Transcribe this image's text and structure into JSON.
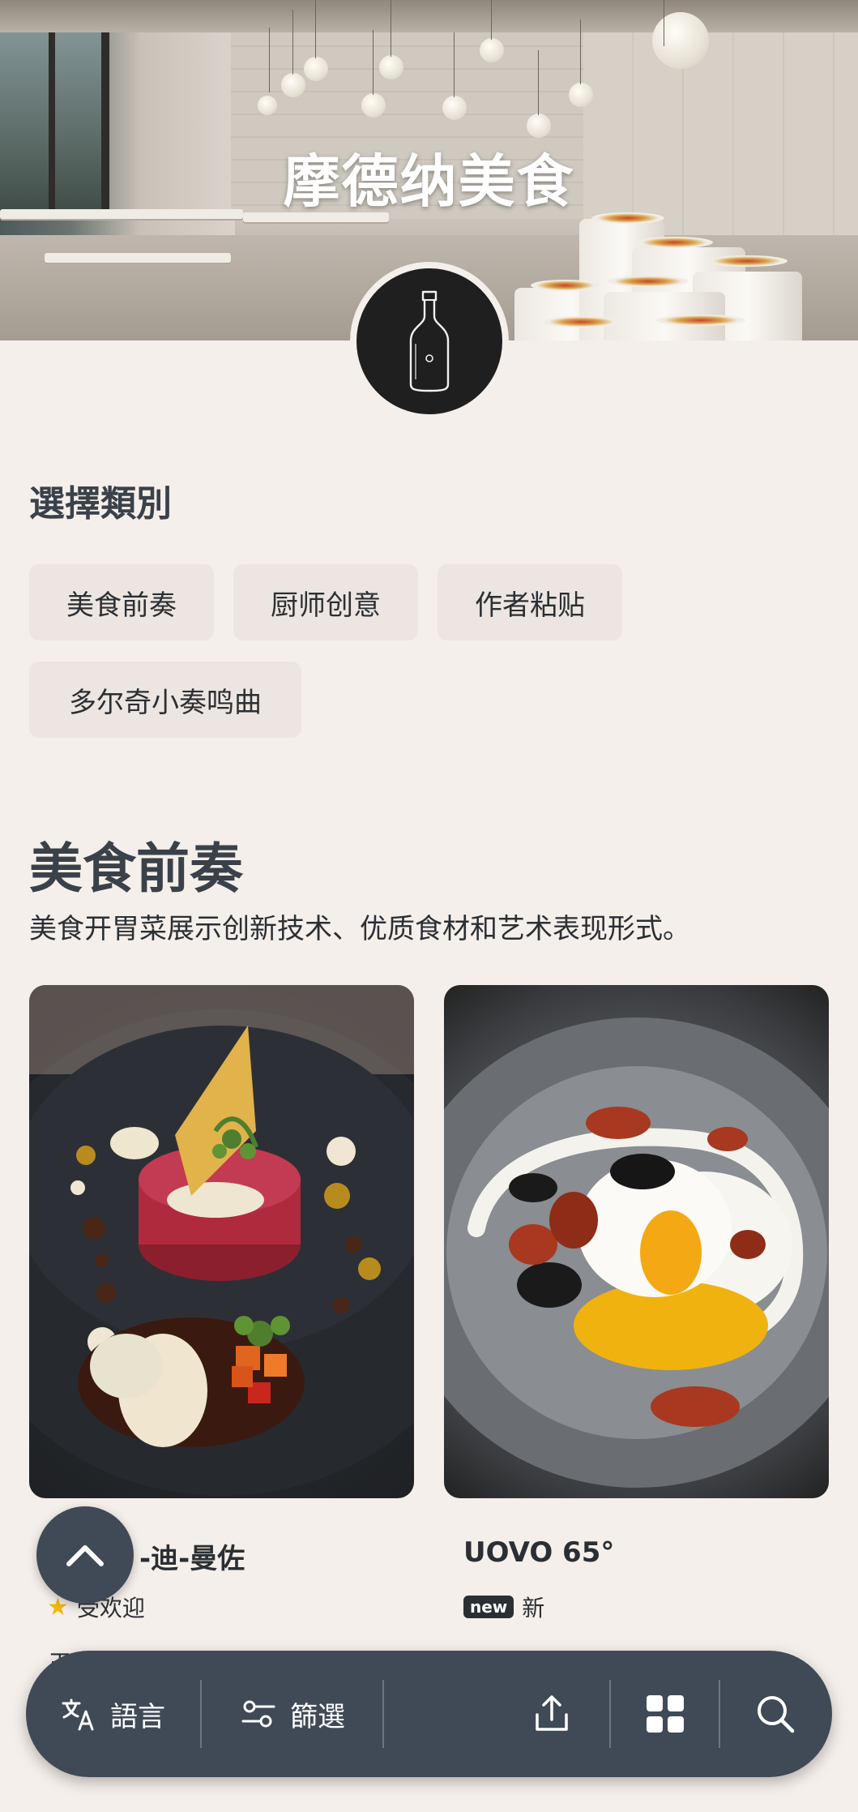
{
  "header": {
    "title": "摩德纳美食"
  },
  "categories": {
    "title": "選擇類別",
    "chips": [
      {
        "label": "美食前奏"
      },
      {
        "label": "厨师创意"
      },
      {
        "label": "作者粘贴"
      },
      {
        "label": "多尔奇小奏鸣曲"
      }
    ]
  },
  "section": {
    "title": "美食前奏",
    "description": "美食开胃菜展示创新技术、优质食材和艺术表现形式。"
  },
  "cards": [
    {
      "name": "-迪-曼佐",
      "tag_label": "受欢迎",
      "tag_icon": "star-icon",
      "cut_text": "玉"
    },
    {
      "name": "UOVO 65°",
      "tag_badge": "new",
      "tag_label": "新",
      "cut_text": ""
    }
  ],
  "bottom_bar": {
    "language_label": "語言",
    "filter_label": "篩選"
  },
  "colors": {
    "background": "#f5efeb",
    "bar": "#3f4a56",
    "chip": "#ece5e1",
    "star": "#f2b80a"
  }
}
